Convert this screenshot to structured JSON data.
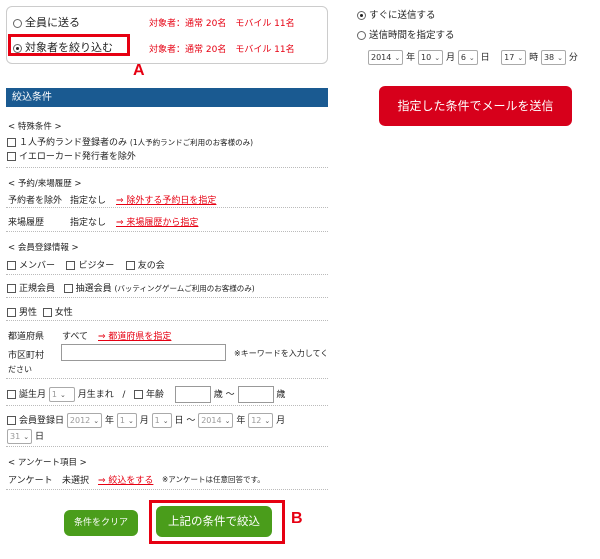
{
  "target": {
    "all_label": "全員に送る",
    "all_counts": "対象者：通常 20名　モバイル 11名",
    "narrow_label": "対象者を絞り込む",
    "narrow_counts": "対象者：通常 20名　モバイル 11名"
  },
  "send": {
    "now_label": "すぐに送信する",
    "schedule_label": "送信時間を指定する",
    "year": "2014",
    "year_unit": "年",
    "month": "10",
    "month_unit": "月",
    "day": "6",
    "day_unit": "日",
    "hour": "17",
    "hour_unit": "時",
    "minute": "38",
    "minute_unit": "分",
    "submit_label": "指定した条件でメールを送信"
  },
  "filter": {
    "header": "絞込条件",
    "special": {
      "title": "< 特殊条件 >",
      "option1": "１人予約ランド登録者のみ",
      "option1_note": "(1人予約ランドご利用のお客様のみ)",
      "option2": "イエローカード発行者を除外"
    },
    "history": {
      "title": "< 予約/来場履歴 >",
      "exclude_label": "予約者を除外",
      "exclude_value": "指定なし",
      "exclude_link": "⇒ 除外する予約日を指定",
      "visit_label": "来場履歴",
      "visit_value": "指定なし",
      "visit_link": "⇒ 来場履歴から指定"
    },
    "member": {
      "title": "< 会員登録情報 >",
      "member": "メンバー",
      "visitor": "ビジター",
      "friend": "友の会",
      "regular": "正規会員",
      "lottery": "抽選会員",
      "lottery_note": "(バッティングゲームご利用のお客様のみ)",
      "male": "男性",
      "female": "女性",
      "pref_label": "都道府県",
      "pref_value": "すべて",
      "pref_link": "⇒ 都道府県を指定",
      "city_label": "市区町村",
      "city_note_1": "※キーワードを入力してく",
      "city_note_2": "ださい",
      "birth_label": "誕生月",
      "birth_month": "1",
      "birth_suffix": "月生まれ",
      "slash": "/",
      "age_label": "年齢",
      "age_from_unit": "歳 〜",
      "age_to_unit": "歳",
      "reg_label": "会員登録日",
      "reg_from_year": "2012",
      "reg_from_month": "1",
      "reg_from_day": "1",
      "reg_to_year": "2014",
      "reg_to_month": "12",
      "reg_to_day": "31",
      "u_year": "年",
      "u_month": "月",
      "u_day_tilde": "日 〜",
      "u_day": "日"
    },
    "survey": {
      "title": "< アンケート項目 >",
      "label": "アンケート",
      "value": "未選択",
      "link": "⇒ 絞込をする",
      "note": "※アンケートは任意回答です。"
    },
    "clear_label": "条件をクリア",
    "apply_label": "上記の条件で絞込"
  },
  "annotations": {
    "a": "A",
    "b": "B"
  }
}
